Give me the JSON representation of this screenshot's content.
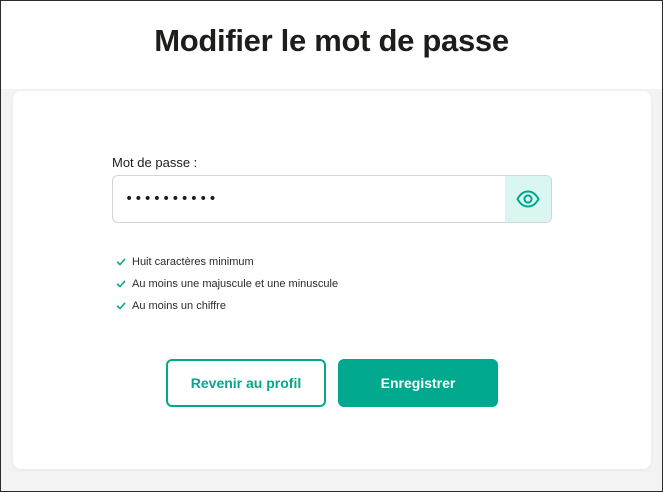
{
  "page": {
    "title": "Modifier le mot de passe"
  },
  "form": {
    "password_label": "Mot de passe :",
    "password_value": "••••••••••",
    "reveal_icon": "eye-icon",
    "rules": [
      {
        "text": "Huit caractères minimum",
        "met": true
      },
      {
        "text": "Au moins une majuscule et une minuscule",
        "met": true
      },
      {
        "text": "Au moins un chiffre",
        "met": true
      }
    ],
    "check_icon": "check-icon"
  },
  "actions": {
    "back_label": "Revenir au profil",
    "save_label": "Enregistrer"
  },
  "colors": {
    "accent": "#00a88e",
    "accent_light": "#d9f7f0",
    "background": "#f3f3f3",
    "text": "#1d1d1b"
  }
}
